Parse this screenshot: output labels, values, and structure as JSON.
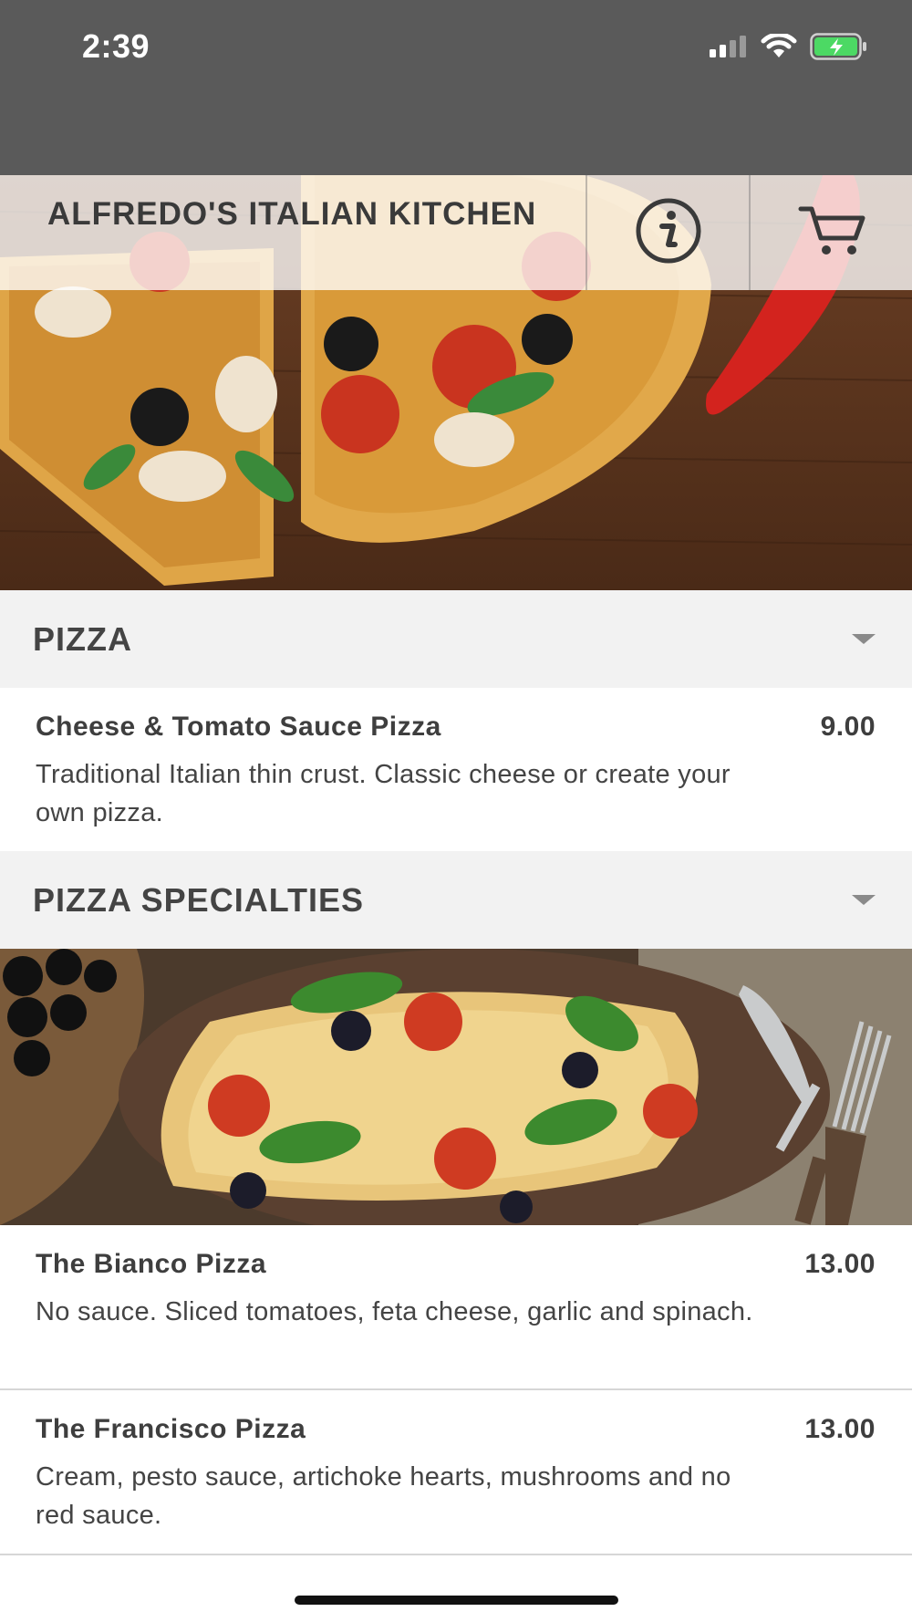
{
  "status_bar": {
    "time": "2:39",
    "icons": [
      "signal-icon",
      "wifi-icon",
      "battery-charging-icon"
    ],
    "battery_color": "#4cd964"
  },
  "header": {
    "title": "ALFREDO'S ITALIAN KITCHEN",
    "info_icon": "info-icon",
    "cart_icon": "cart-icon"
  },
  "sections": [
    {
      "title": "PIZZA",
      "items": [
        {
          "name": "Cheese & Tomato Sauce Pizza",
          "price": "9.00",
          "description": "Traditional Italian thin crust. Classic cheese or create your own pizza."
        }
      ]
    },
    {
      "title": "PIZZA SPECIALTIES",
      "items": [
        {
          "name": "The Bianco Pizza",
          "price": "13.00",
          "description": "No sauce. Sliced tomatoes, feta cheese, garlic and spinach."
        },
        {
          "name": "The Francisco Pizza",
          "price": "13.00",
          "description": "Cream, pesto sauce, artichoke hearts, mushrooms and no red sauce."
        }
      ]
    }
  ],
  "colors": {
    "status_bar_bg": "#5a5a5a",
    "section_header_bg": "#f2f2f2",
    "text": "#3a3a3a"
  }
}
